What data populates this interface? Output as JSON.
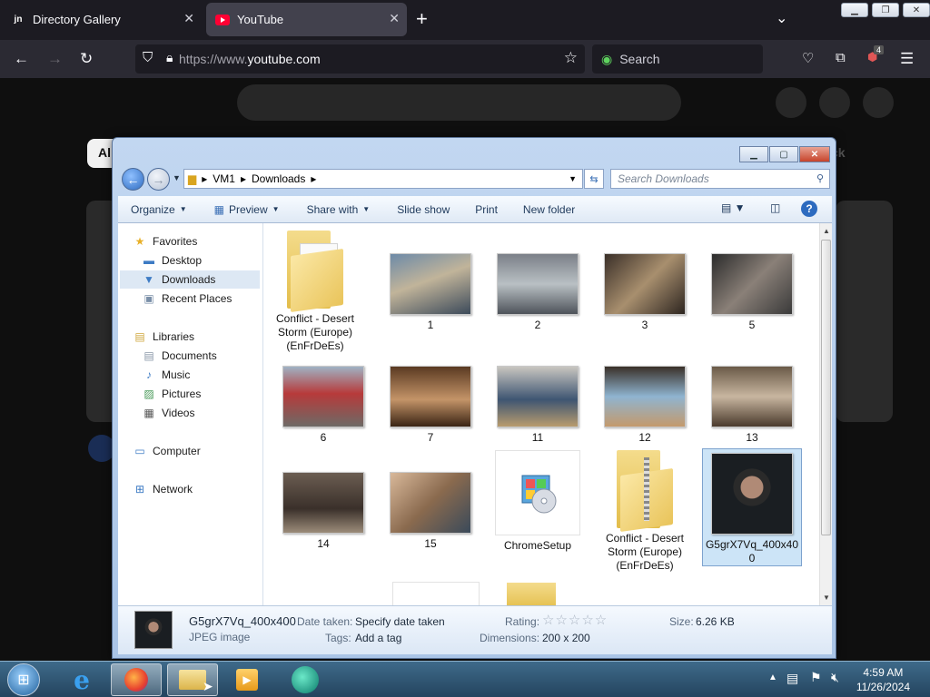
{
  "browser": {
    "tabs": [
      {
        "label": "Directory Gallery",
        "favicon": "jn-icon",
        "active": false
      },
      {
        "label": "YouTube",
        "favicon": "youtube-icon",
        "active": true
      }
    ],
    "url_scheme": "https://www.",
    "url_host": "youtube.com",
    "search_placeholder": "Search",
    "extension_badge": "4"
  },
  "youtube_partial": {
    "chip_left": "Al",
    "chip_right": "ck"
  },
  "explorer": {
    "address": {
      "root": "VM1",
      "folder": "Downloads"
    },
    "search_placeholder": "Search Downloads",
    "toolbar": {
      "organize": "Organize",
      "preview": "Preview",
      "share_with": "Share with",
      "slide_show": "Slide show",
      "print": "Print",
      "new_folder": "New folder"
    },
    "nav": {
      "favorites": "Favorites",
      "desktop": "Desktop",
      "downloads": "Downloads",
      "recent_places": "Recent Places",
      "libraries": "Libraries",
      "documents": "Documents",
      "music": "Music",
      "pictures": "Pictures",
      "videos": "Videos",
      "computer": "Computer",
      "network": "Network"
    },
    "files": {
      "folder1": "Conflict - Desert Storm (Europe) (EnFrDeEs)",
      "p1": "1",
      "p2": "2",
      "p3": "3",
      "p5": "5",
      "p6": "6",
      "p7": "7",
      "p11": "11",
      "p12": "12",
      "p13": "13",
      "p14": "14",
      "p15": "15",
      "chrome": "ChromeSetup",
      "zip": "Conflict - Desert Storm (Europe) (EnFrDeEs)",
      "selected": "G5grX7Vq_400x400"
    },
    "details": {
      "name": "G5grX7Vq_400x400",
      "type": "JPEG image",
      "date_taken_label": "Date taken:",
      "date_taken_value": "Specify date taken",
      "tags_label": "Tags:",
      "tags_value": "Add a tag",
      "rating_label": "Rating:",
      "dimensions_label": "Dimensions:",
      "dimensions_value": "200 x 200",
      "size_label": "Size:",
      "size_value": "6.26 KB"
    }
  },
  "taskbar": {
    "time": "4:59 AM",
    "date": "11/26/2024"
  }
}
